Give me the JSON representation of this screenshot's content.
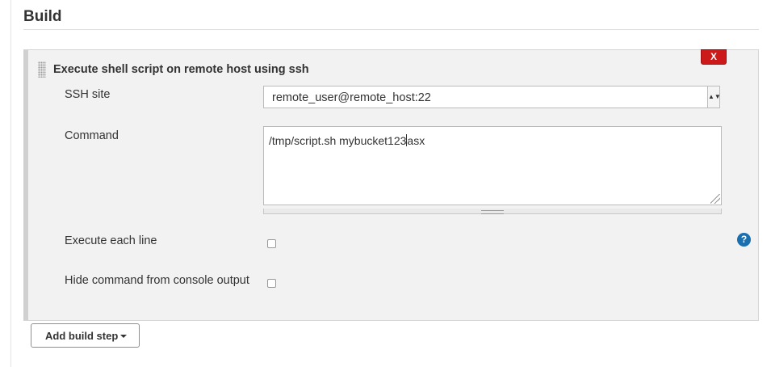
{
  "section": {
    "title": "Build"
  },
  "step": {
    "title": "Execute shell script on remote host using ssh",
    "delete_label": "X",
    "fields": {
      "ssh_site": {
        "label": "SSH site",
        "value": "remote_user@remote_host:22",
        "arrow": "▲▼"
      },
      "command": {
        "label": "Command",
        "text_before_caret": "/tmp/script.sh mybucket123",
        "text_after_caret": "asx"
      },
      "execute_each_line": {
        "label": "Execute each line",
        "checked": false
      },
      "hide_command": {
        "label": "Hide command from console output",
        "checked": false
      }
    },
    "help_label": "?"
  },
  "add_build_step": {
    "label": "Add build step"
  },
  "colors": {
    "delete": "#cc1a1a",
    "help": "#1a6fae",
    "panel": "#f2f2f2"
  }
}
